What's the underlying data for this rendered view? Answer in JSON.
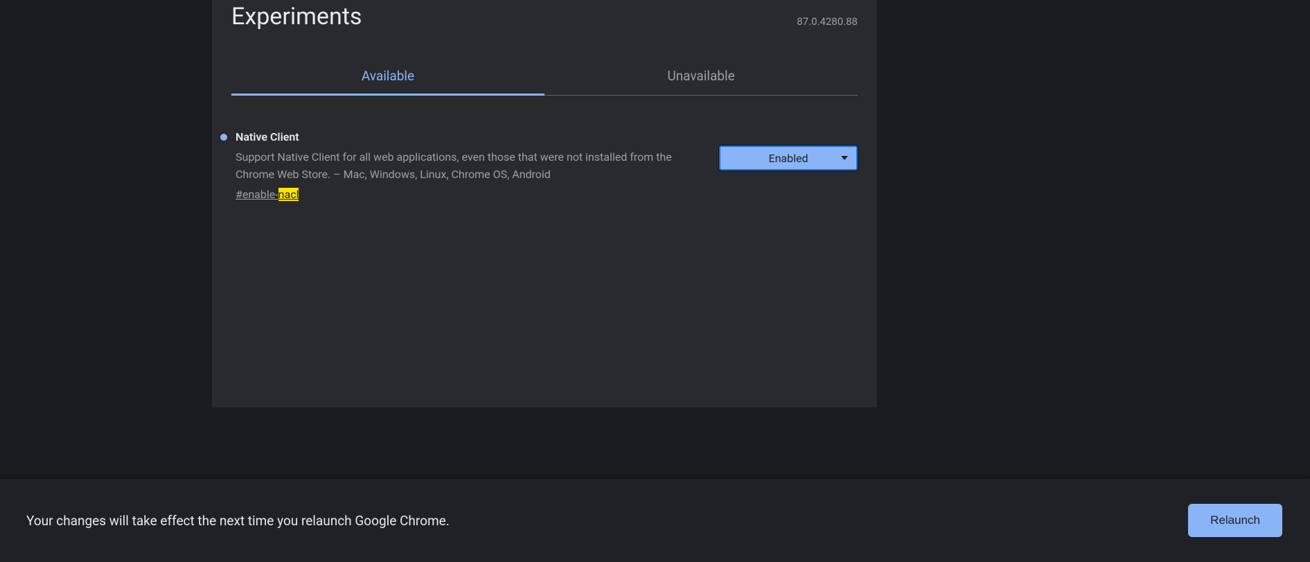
{
  "header": {
    "title": "Experiments",
    "version": "87.0.4280.88"
  },
  "tabs": {
    "available": "Available",
    "unavailable": "Unavailable"
  },
  "flag": {
    "title": "Native Client",
    "description": "Support Native Client for all web applications, even those that were not installed from the Chrome Web Store. – Mac, Windows, Linux, Chrome OS, Android",
    "link_prefix": "#enable-",
    "link_highlight": "nacl",
    "select_value": "Enabled"
  },
  "footer": {
    "message": "Your changes will take effect the next time you relaunch Google Chrome.",
    "button": "Relaunch"
  }
}
